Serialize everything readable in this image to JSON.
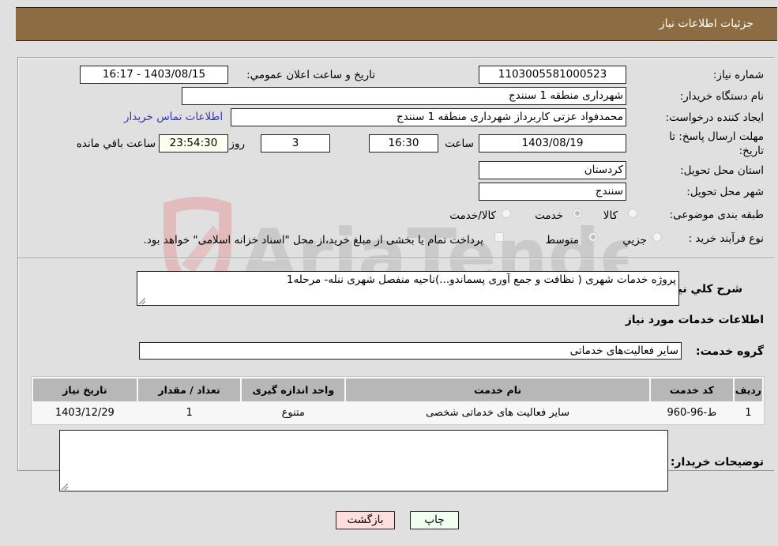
{
  "header": {
    "title": "جزئیات اطلاعات نیاز"
  },
  "form": {
    "need_number": {
      "label": "شماره نیاز:",
      "value": "1103005581000523"
    },
    "announce_datetime": {
      "label": "تاریخ و ساعت اعلان عمومي:",
      "value": "1403/08/15 - 16:17"
    },
    "buyer_org": {
      "label": "نام دستگاه خریدار:",
      "value": "شهرداری منطقه 1 سنندج"
    },
    "requester": {
      "label": "ایجاد کننده درخواست:",
      "value": "محمدفواد عزتی کاربرداز شهرداری منطقه 1 سنندج"
    },
    "buyer_contact_link": "اطلاعات تماس خریدار",
    "deadline": {
      "label": "مهلت ارسال پاسخ: تا تاریخ:",
      "date": "1403/08/19",
      "time_label": "ساعت",
      "time": "16:30",
      "days": "3",
      "days_label": "روز و",
      "remaining": "23:54:30",
      "remaining_label": "ساعت باقي مانده"
    },
    "province": {
      "label": "استان محل تحویل:",
      "value": "کردستان"
    },
    "city": {
      "label": "شهر محل تحویل:",
      "value": "سنندج"
    },
    "category": {
      "label": "طبقه بندی موضوعی:",
      "options": [
        "کالا",
        "خدمت",
        "کالا/خدمت"
      ],
      "selected": "خدمت"
    },
    "purchase_type": {
      "label": "نوع فرآیند خرید :",
      "options": [
        "جزيي",
        "متوسط"
      ],
      "selected": "متوسط",
      "treasury_note": "پرداخت تمام یا بخشی از مبلغ خرید،از محل \"اسناد خزانه اسلامی\" خواهد بود."
    },
    "description": {
      "label": "شرح کلي نیاز:",
      "value": "پروژه خدمات شهری ( نظافت و جمع آوری پسماندو...)ناحیه منفصل شهری ننله- مرحله1"
    },
    "services_title": "اطلاعات خدمات مورد نیاز",
    "service_group": {
      "label": "گروه خدمت:",
      "value": "سایر فعالیت‌های خدماتی"
    }
  },
  "table": {
    "headers": [
      "ردیف",
      "کد خدمت",
      "نام خدمت",
      "واحد اندازه گیری",
      "تعداد / مقدار",
      "تاریخ نیاز"
    ],
    "rows": [
      [
        "1",
        "ط-96-960",
        "سایر فعالیت های خدماتی شخصی",
        "متنوع",
        "1",
        "1403/12/29"
      ]
    ]
  },
  "buyer_notes": {
    "label": "توضیحات خریدار:",
    "value": ""
  },
  "buttons": {
    "print": "چاپ",
    "back": "بازگشت"
  },
  "colors": {
    "header_bg": "#8c6c43",
    "print_bg": "#f0fff0",
    "back_bg": "#ffdede",
    "link": "#3333cc"
  }
}
